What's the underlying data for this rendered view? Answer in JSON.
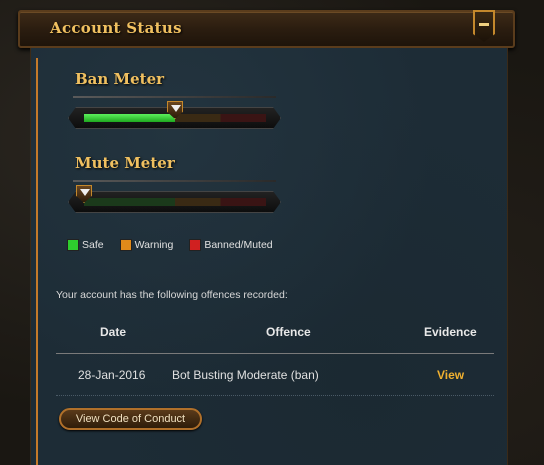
{
  "header": {
    "title": "Account Status",
    "collapse_icon": "minus-icon"
  },
  "meters": {
    "ban": {
      "title": "Ban Meter",
      "level": 0.5
    },
    "mute": {
      "title": "Mute Meter",
      "level": 0.0
    }
  },
  "legend": [
    {
      "label": "Safe",
      "color": "#2ecc2e"
    },
    {
      "label": "Warning",
      "color": "#e08a1a"
    },
    {
      "label": "Banned/Muted",
      "color": "#d02020"
    }
  ],
  "offences": {
    "intro": "Your account has the following offences recorded:",
    "columns": {
      "date": "Date",
      "offence": "Offence",
      "evidence": "Evidence"
    },
    "rows": [
      {
        "date": "28-Jan-2016",
        "offence": "Bot Busting Moderate (ban)",
        "evidence": "View"
      }
    ]
  },
  "actions": {
    "code_of_conduct": "View Code of Conduct"
  },
  "colors": {
    "accent_gold": "#f0c060",
    "link": "#f0b030",
    "panel": "#1d2c36"
  }
}
